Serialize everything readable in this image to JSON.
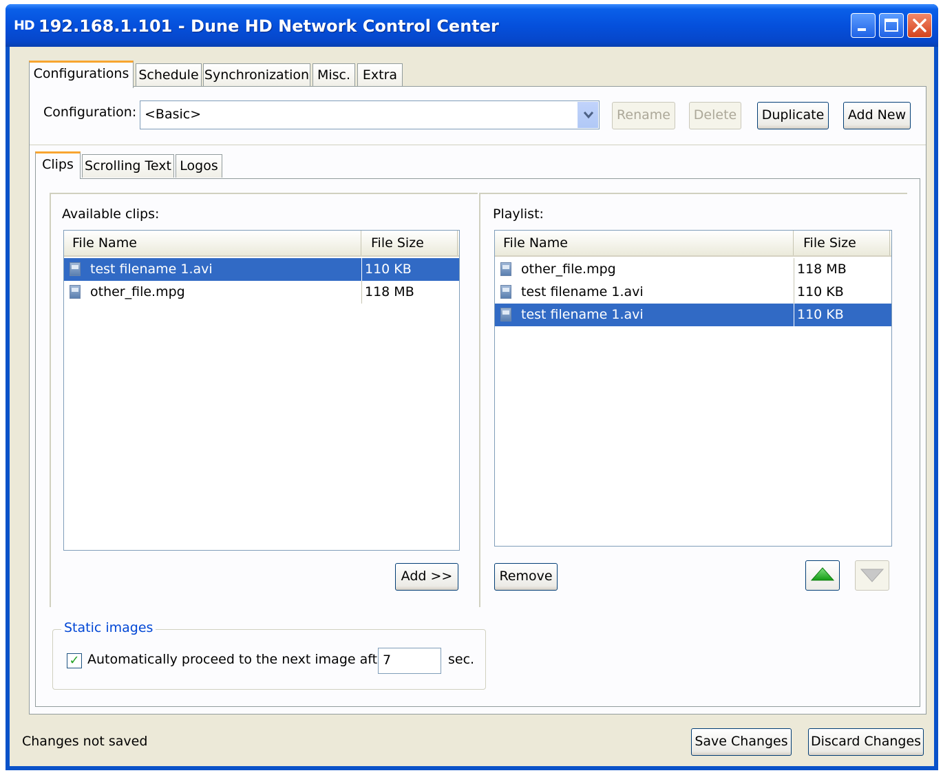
{
  "window": {
    "logo": "HD",
    "title": "192.168.1.101 - Dune HD Network Control Center"
  },
  "outer_tabs": [
    "Configurations",
    "Schedule",
    "Synchronization",
    "Misc.",
    "Extra"
  ],
  "config": {
    "label": "Configuration:",
    "selected": "<Basic>",
    "rename": "Rename",
    "delete": "Delete",
    "duplicate": "Duplicate",
    "add_new": "Add New"
  },
  "inner_tabs": [
    "Clips",
    "Scrolling Text",
    "Logos"
  ],
  "available": {
    "label": "Available clips:",
    "col_name": "File Name",
    "col_size": "File Size",
    "rows": [
      {
        "name": "test filename 1.avi",
        "size": "110 KB",
        "selected": true
      },
      {
        "name": "other_file.mpg",
        "size": "118 MB",
        "selected": false
      }
    ],
    "add_button": "Add >>"
  },
  "playlist": {
    "label": "Playlist:",
    "col_name": "File Name",
    "col_size": "File Size",
    "rows": [
      {
        "name": "other_file.mpg",
        "size": "118 MB",
        "selected": false
      },
      {
        "name": "test filename 1.avi",
        "size": "110 KB",
        "selected": false
      },
      {
        "name": "test filename 1.avi",
        "size": "110 KB",
        "selected": true
      }
    ],
    "remove_button": "Remove"
  },
  "static_images": {
    "legend": "Static images",
    "checkbox_label": "Automatically proceed to the next image after",
    "checked": true,
    "seconds": "7",
    "unit": "sec."
  },
  "footer": {
    "status": "Changes not saved",
    "save": "Save Changes",
    "discard": "Discard Changes"
  },
  "colors": {
    "titlebar": "#0550dc",
    "selection": "#316ac5",
    "panel": "#ece9d8",
    "legend": "#0046d5"
  }
}
